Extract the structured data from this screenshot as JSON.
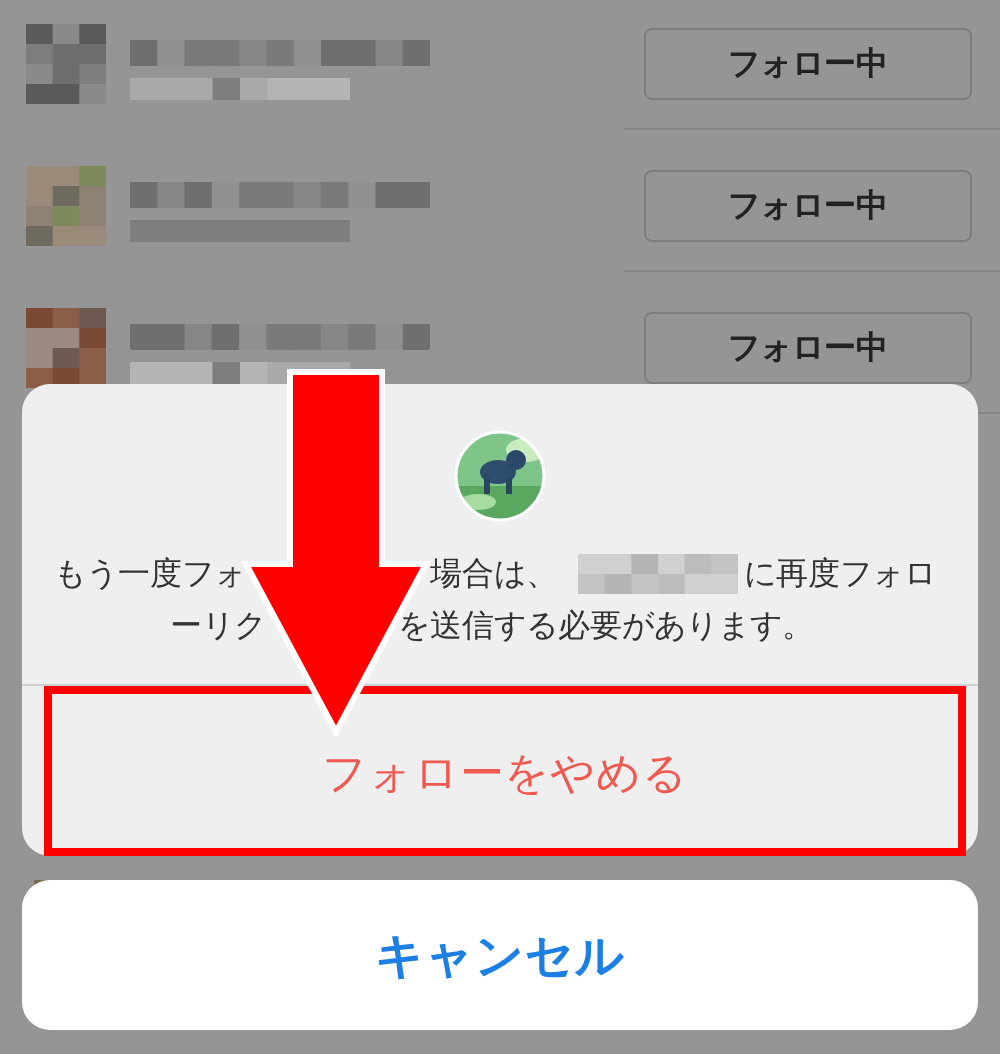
{
  "following_list": {
    "rows": [
      {
        "button": "フォロー中"
      },
      {
        "button": "フォロー中"
      },
      {
        "button": "フォロー中"
      }
    ]
  },
  "unfollow_sheet": {
    "message": {
      "lines": [
        [
          {
            "kind": "text",
            "text": "もう一度フォ"
          },
          {
            "kind": "text",
            "text": "場合は、"
          },
          {
            "kind": "redacted"
          },
          {
            "kind": "text",
            "text": "に再度フォロ"
          }
        ],
        [
          {
            "kind": "text",
            "text": "ーリク"
          },
          {
            "kind": "text",
            "text": "を送信する必要があります。"
          }
        ]
      ]
    },
    "confirm_button": "フォローをやめる",
    "confirm_highlighted": true
  },
  "cancel_button": "キャンセル"
}
